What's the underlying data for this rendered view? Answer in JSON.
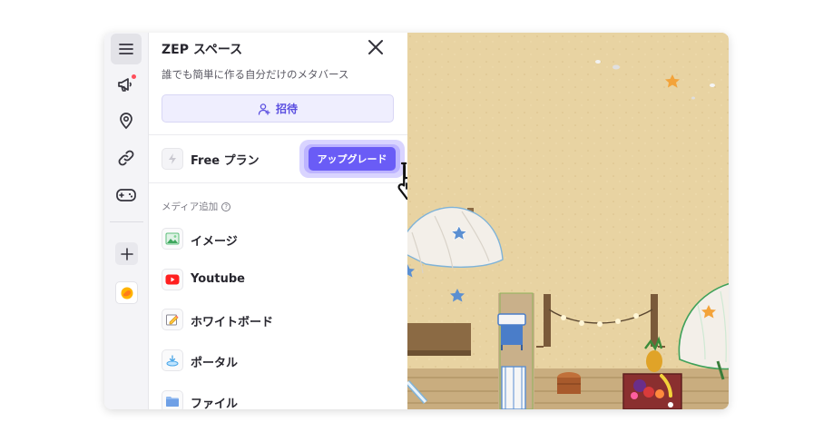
{
  "panel": {
    "title": "ZEP スペース",
    "subtitle": "誰でも簡単に作る自分だけのメタバース",
    "invite_label": "招待",
    "plan_label": "Free プラン",
    "upgrade_label": "アップグレード",
    "media_section_title": "メディア追加",
    "media_items": [
      {
        "label": "イメージ",
        "icon": "image-icon"
      },
      {
        "label": "Youtube",
        "icon": "youtube-icon"
      },
      {
        "label": "ホワイトボード",
        "icon": "whiteboard-icon"
      },
      {
        "label": "ポータル",
        "icon": "portal-icon"
      },
      {
        "label": "ファイル",
        "icon": "folder-icon"
      }
    ]
  },
  "rail": {
    "icons": [
      "menu-icon",
      "megaphone-icon",
      "location-pin-icon",
      "link-icon",
      "gamepad-icon",
      "plus-icon",
      "space-avatar-icon"
    ]
  },
  "colors": {
    "accent": "#6a5cf6",
    "invite_bg": "#efeefe",
    "sand": "#e8d3a2",
    "notification": "#ff4f5b"
  }
}
